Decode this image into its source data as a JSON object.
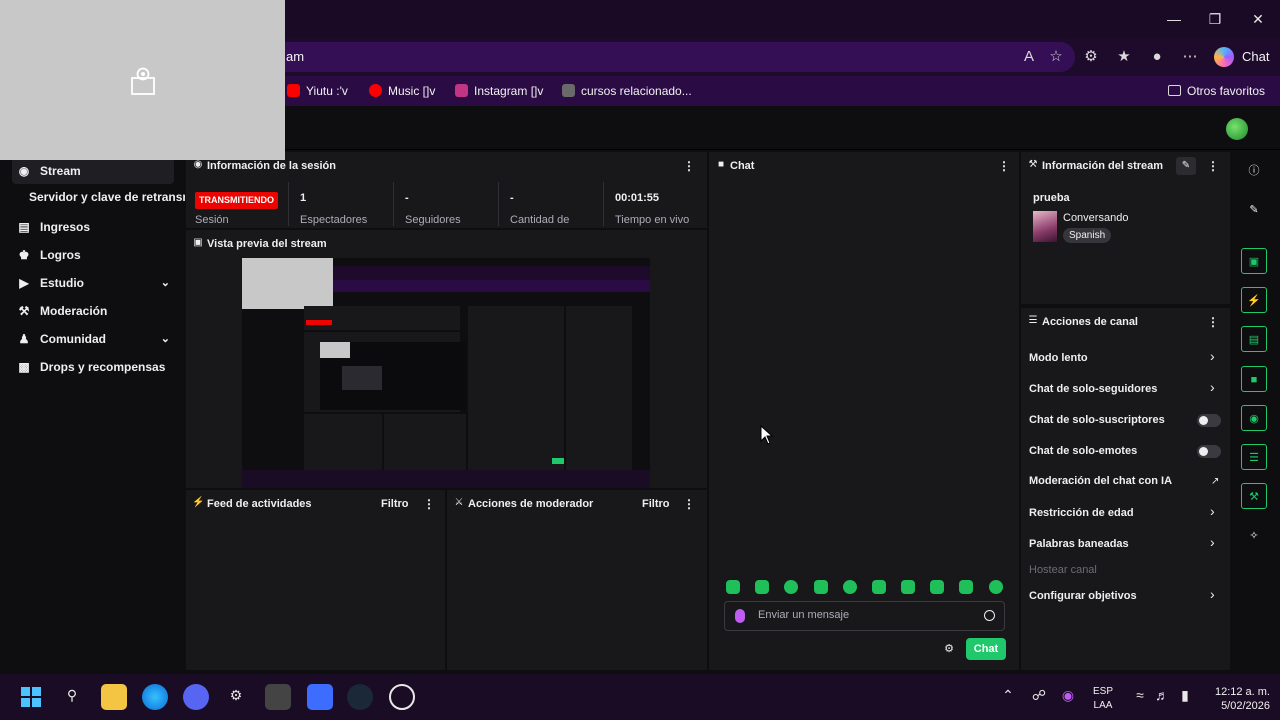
{
  "browser": {
    "url_fragment": "am",
    "copilot_label": "Chat",
    "favorites": [
      {
        "label": "Yiutu :'v",
        "color": "#ff0000"
      },
      {
        "label": "Music []v",
        "color": "#ff0000"
      },
      {
        "label": "Instagram []v",
        "color": "#c13584"
      },
      {
        "label": "cursos relacionado...",
        "color": "#6a6a6a"
      }
    ],
    "other_favorites": "Otros favoritos"
  },
  "nav": {
    "items": [
      {
        "label": "Stream",
        "icon": "broadcast-icon"
      },
      {
        "label": "Servidor y clave de retransmisión"
      },
      {
        "label": "Ingresos",
        "icon": "chart-icon"
      },
      {
        "label": "Logros",
        "icon": "trophy-icon"
      },
      {
        "label": "Estudio",
        "icon": "video-icon"
      },
      {
        "label": "Moderación",
        "icon": "wrench-icon"
      },
      {
        "label": "Comunidad",
        "icon": "people-icon"
      },
      {
        "label": "Drops y recompensas",
        "icon": "gift-icon"
      }
    ]
  },
  "session": {
    "title": "Información de la sesión",
    "status": "TRANSMITIENDO",
    "status_label": "Sesión",
    "stats": [
      {
        "value": "1",
        "label": "Espectadores"
      },
      {
        "value": "-",
        "label": "Seguidores"
      },
      {
        "value": "-",
        "label": "Cantidad de"
      },
      {
        "value": "00:01:55",
        "label": "Tiempo en vivo"
      }
    ]
  },
  "preview": {
    "title": "Vista previa del stream"
  },
  "activity": {
    "title": "Feed de actividades",
    "filter": "Filtro"
  },
  "modactions": {
    "title": "Acciones de moderador",
    "filter": "Filtro"
  },
  "chat": {
    "title": "Chat",
    "placeholder": "Enviar un mensaje",
    "send_label": "Chat"
  },
  "stream_info": {
    "title": "Información del stream",
    "stream_title": "prueba",
    "category": "Conversando",
    "tag": "Spanish"
  },
  "channel_actions": {
    "title": "Acciones de canal",
    "items": [
      {
        "label": "Modo lento",
        "control": "chevron"
      },
      {
        "label": "Chat de solo-seguidores",
        "control": "chevron"
      },
      {
        "label": "Chat de solo-suscriptores",
        "control": "toggle"
      },
      {
        "label": "Chat de solo-emotes",
        "control": "toggle"
      },
      {
        "label": "Moderación del chat con IA",
        "control": "external"
      },
      {
        "label": "Restricción de edad",
        "control": "chevron"
      },
      {
        "label": "Palabras baneadas",
        "control": "chevron"
      },
      {
        "label": "Hostear canal",
        "control": "none"
      },
      {
        "label": "Configurar objetivos",
        "control": "chevron"
      }
    ]
  },
  "taskbar": {
    "lang_top": "ESP",
    "lang_bottom": "LAA",
    "time": "12:12 a. m.",
    "date": "5/02/2026"
  }
}
